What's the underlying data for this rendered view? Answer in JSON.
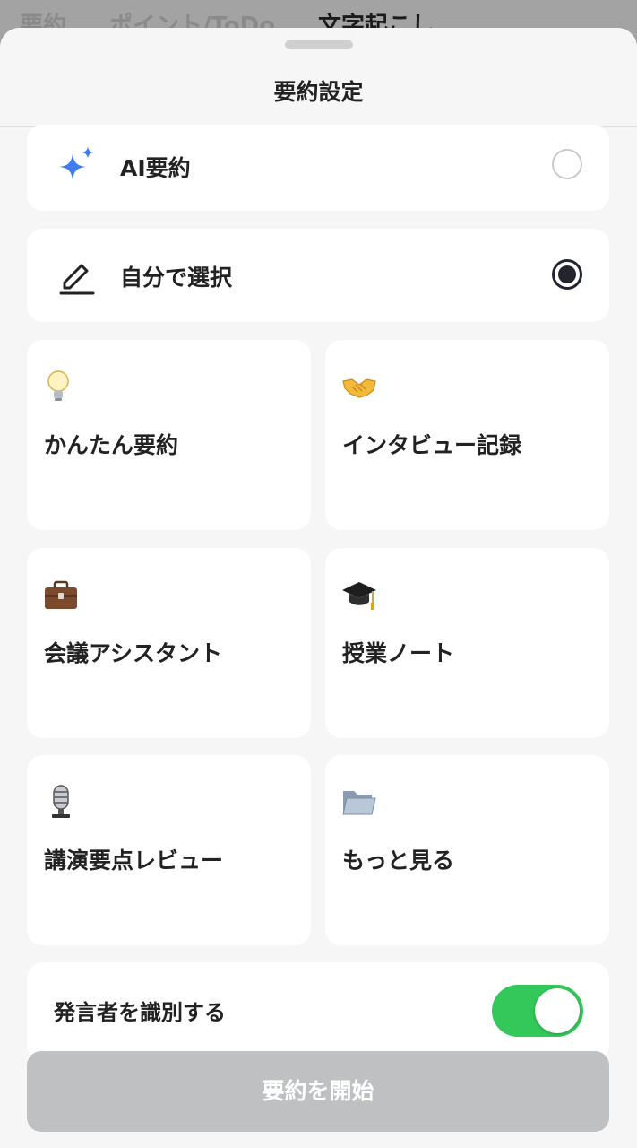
{
  "background_tabs": [
    "要約",
    "ポイント/ToDo",
    "文字起こし"
  ],
  "sheet": {
    "title": "要約設定"
  },
  "options": [
    {
      "label": "AI要約",
      "icon": "sparkle-icon",
      "selected": false
    },
    {
      "label": "自分で選択",
      "icon": "pencil-icon",
      "selected": true
    }
  ],
  "templates": [
    {
      "label": "かんたん要約",
      "icon": "lightbulb-icon",
      "emoji": "💡"
    },
    {
      "label": "インタビュー記録",
      "icon": "handshake-icon",
      "emoji": "🤝"
    },
    {
      "label": "会議アシスタント",
      "icon": "briefcase-icon",
      "emoji": "💼"
    },
    {
      "label": "授業ノート",
      "icon": "graduation-cap-icon",
      "emoji": "🎓"
    },
    {
      "label": "講演要点レビュー",
      "icon": "microphone-icon",
      "emoji": "🎙"
    },
    {
      "label": "もっと見る",
      "icon": "folder-icon",
      "emoji": "📂"
    }
  ],
  "speaker_toggle": {
    "label": "発言者を識別する",
    "on": true
  },
  "start_button": {
    "label": "要約を開始"
  },
  "colors": {
    "accent_blue": "#3f7cf0",
    "toggle_green": "#34c759",
    "radio_selected": "#22252e",
    "button_disabled": "#bfc0c2"
  }
}
